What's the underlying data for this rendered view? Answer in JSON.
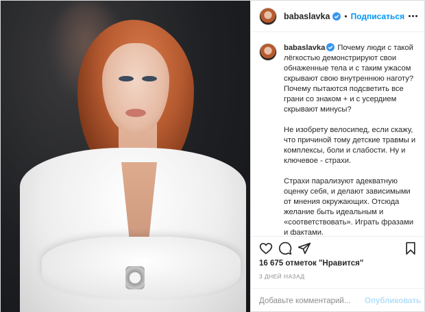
{
  "post": {
    "username": "babaslavka",
    "follow_label": "Подписаться",
    "separator": "•",
    "caption_paragraphs": [
      "Почему люди с такой лёгкостью демонстрируют свои обнаженные тела и с таким ужасом скрывают свою внутреннюю наготу? Почему пытаются подсветить все грани со знаком + и с усердием скрывают минусы?",
      "Не изобрету велосипед, если скажу, что причиной тому детские травмы и комплексы, боли и слабости. Ну и ключевое - страхи.",
      "Страхи парализуют адекватную оценку себя, и делают зависимыми от мнения окружающих. Отсюда желание быть идеальным и «соответствовать». Играть фразами и фактами."
    ],
    "likes": "16 675 отметок \"Нравится\"",
    "time_ago": "3 дней назад"
  },
  "comment_box": {
    "placeholder": "Добавьте комментарий...",
    "publish_label": "Опубликовать"
  },
  "icons": {
    "like": "heart-icon",
    "comment": "comment-icon",
    "share": "share-icon",
    "save": "bookmark-icon",
    "more": "more-options-icon",
    "verified": "verified-badge-icon"
  },
  "colors": {
    "accent": "#0095f6",
    "verified": "#3897f0",
    "publish_disabled": "#b2dffc",
    "muted": "#8e8e8e"
  }
}
